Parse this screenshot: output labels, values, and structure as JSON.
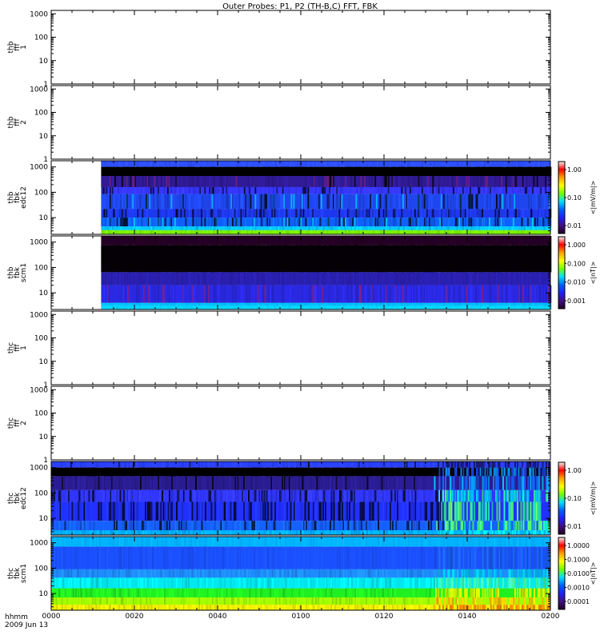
{
  "title": "Outer Probes: P1, P2 (TH-B,C) FFT, FBK",
  "footer": {
    "line1": "hhmm",
    "line2": "2009 Jun 13"
  },
  "time_ticks": [
    "0000",
    "0020",
    "0040",
    "0100",
    "0120",
    "0140",
    "0200"
  ],
  "colors": {
    "axis": "#000000",
    "background": "#ffffff"
  },
  "chart_data": [
    {
      "type": "heatmap",
      "ylabel": [
        "thb",
        "fff",
        "1"
      ],
      "ytick_labels": [
        "1",
        "10",
        "100",
        "1000"
      ],
      "ylim": [
        1,
        1400
      ],
      "yscale": "log",
      "has_data": false
    },
    {
      "type": "heatmap",
      "ylabel": [
        "thb",
        "fff",
        "2"
      ],
      "ytick_labels": [
        "1",
        "10",
        "100",
        "1000"
      ],
      "ylim": [
        1,
        1400
      ],
      "yscale": "log",
      "has_data": false
    },
    {
      "type": "heatmap",
      "ylabel": [
        "thb",
        "fbk",
        "edc12"
      ],
      "ytick_labels": [
        "10",
        "100",
        "1000"
      ],
      "ylim": [
        2.2,
        1750
      ],
      "yscale": "log",
      "has_data": true,
      "data_start_minute": 12,
      "bands": [
        {
          "lo": 1000,
          "hi": 1750,
          "c": "#2e50ff",
          "var": 0.2,
          "dark": 0
        },
        {
          "lo": 440,
          "hi": 1000,
          "c": "#000000",
          "var": 0,
          "dark": 0
        },
        {
          "lo": 160,
          "hi": 440,
          "c": "#301a95",
          "var": 0.3,
          "dark": 0.1,
          "accent": "#6a1e80"
        },
        {
          "lo": 85,
          "hi": 160,
          "c": "#3536ff",
          "var": 0.35,
          "dark": 0.2
        },
        {
          "lo": 22,
          "hi": 85,
          "c": "#1f46ee",
          "var": 0.45,
          "dark": 0.15,
          "accent": "#00b4ff"
        },
        {
          "lo": 10,
          "hi": 22,
          "c": "#1e38f0",
          "var": 0.45,
          "dark": 0.25
        },
        {
          "lo": 4.5,
          "hi": 10,
          "c": "#0f60ff",
          "var": 0.5,
          "dark": 0.3,
          "accent": "#00c8ff"
        },
        {
          "lo": 3.2,
          "hi": 4.5,
          "c": "#00c8ff",
          "var": 0.3,
          "dark": 0
        },
        {
          "lo": 2.2,
          "hi": 3.2,
          "c": "#7cf200",
          "var": 0.2,
          "dark": 0
        }
      ],
      "colorbar": {
        "label": "<|mV/m|>",
        "ticks": [
          "1.00",
          "0.10",
          "0.01"
        ]
      }
    },
    {
      "type": "heatmap",
      "ylabel": [
        "thb",
        "fbk",
        "scm1"
      ],
      "ytick_labels": [
        "10",
        "100",
        "1000"
      ],
      "ylim": [
        2.2,
        1750
      ],
      "yscale": "log",
      "has_data": true,
      "data_start_minute": 12,
      "bands": [
        {
          "lo": 750,
          "hi": 1750,
          "c": "#250025",
          "var": 0.25,
          "dark": 0
        },
        {
          "lo": 65,
          "hi": 750,
          "c": "#050005",
          "var": 0.1,
          "dark": 0
        },
        {
          "lo": 20,
          "hi": 65,
          "c": "#2a20b0",
          "var": 0.2,
          "dark": 0
        },
        {
          "lo": 4,
          "hi": 20,
          "c": "#2a28e0",
          "var": 0.3,
          "dark": 0,
          "accent": "#7a2090"
        },
        {
          "lo": 3,
          "hi": 4,
          "c": "#00c0ff",
          "var": 0.15,
          "dark": 0
        },
        {
          "lo": 2.2,
          "hi": 3,
          "c": "#00d8ff",
          "var": 0.1,
          "dark": 0
        }
      ],
      "colorbar": {
        "label": "<|nT|>",
        "ticks": [
          "1.000",
          "0.100",
          "0.010",
          "0.001"
        ]
      }
    },
    {
      "type": "heatmap",
      "ylabel": [
        "thc",
        "fff",
        "1"
      ],
      "ytick_labels": [
        "1",
        "10",
        "100",
        "1000"
      ],
      "ylim": [
        1,
        1400
      ],
      "yscale": "log",
      "has_data": false
    },
    {
      "type": "heatmap",
      "ylabel": [
        "thc",
        "fff",
        "2"
      ],
      "ytick_labels": [
        "1",
        "10",
        "100",
        "1000"
      ],
      "ylim": [
        1,
        1400
      ],
      "yscale": "log",
      "has_data": false
    },
    {
      "type": "heatmap",
      "ylabel": [
        "thc",
        "fbk",
        "edc12"
      ],
      "ytick_labels": [
        "10",
        "100",
        "1000"
      ],
      "ylim": [
        2.2,
        1750
      ],
      "yscale": "log",
      "has_data": true,
      "data_start_minute": 0,
      "bands": [
        {
          "lo": 1000,
          "hi": 1750,
          "c": "#2a40ff",
          "var": 0.3,
          "dark": 0.05,
          "late": "#1a1a80"
        },
        {
          "lo": 460,
          "hi": 1000,
          "c": "#000000",
          "var": 0,
          "dark": 0,
          "late": "#1a3cd0",
          "late_accent": "#00b0ff"
        },
        {
          "lo": 130,
          "hi": 460,
          "c": "#2a1c90",
          "var": 0.3,
          "dark": 0.1,
          "late": "#1460ff",
          "late_accent": "#00d8ff"
        },
        {
          "lo": 45,
          "hi": 130,
          "c": "#3036ff",
          "var": 0.5,
          "dark": 0.35,
          "late": "#00b8ff",
          "late_accent": "#40ff90"
        },
        {
          "lo": 8,
          "hi": 45,
          "c": "#2030ff",
          "var": 0.5,
          "dark": 0.45,
          "late": "#20e0c0",
          "late_accent": "#70ff50"
        },
        {
          "lo": 3.4,
          "hi": 8,
          "c": "#1660ff",
          "var": 0.5,
          "dark": 0.3,
          "late": "#50ff70",
          "late_accent": "#00d0ff"
        },
        {
          "lo": 2.2,
          "hi": 3.4,
          "c": "#00b0ff",
          "var": 0.3,
          "dark": 0,
          "late": "#00e0ff"
        }
      ],
      "transition_minute": 93,
      "colorbar": {
        "label": "<|mV/m|>",
        "ticks": [
          "1.00",
          "0.10",
          "0.01"
        ]
      }
    },
    {
      "type": "heatmap",
      "ylabel": [
        "thc",
        "fbk",
        "scm1"
      ],
      "ytick_labels": [
        "10",
        "100",
        "1000"
      ],
      "ylim": [
        2.2,
        1750
      ],
      "yscale": "log",
      "has_data": true,
      "data_start_minute": 0,
      "bands": [
        {
          "lo": 700,
          "hi": 1750,
          "c": "#00b4ff",
          "var": 0.15,
          "dark": 0
        },
        {
          "lo": 90,
          "hi": 700,
          "c": "#1a50ff",
          "var": 0.2,
          "dark": 0,
          "late": "#1a60ff"
        },
        {
          "lo": 42,
          "hi": 90,
          "c": "#1e8cff",
          "var": 0.3,
          "dark": 0,
          "late": "#00c8ff"
        },
        {
          "lo": 16,
          "hi": 42,
          "c": "#00e8f0",
          "var": 0.3,
          "dark": 0,
          "late": "#40ffb0"
        },
        {
          "lo": 7,
          "hi": 16,
          "c": "#20f020",
          "var": 0.35,
          "dark": 0,
          "late": "#d0ff00"
        },
        {
          "lo": 3.6,
          "hi": 7,
          "c": "#a0ff00",
          "var": 0.35,
          "dark": 0,
          "late": "#ffd000"
        },
        {
          "lo": 2.2,
          "hi": 3.6,
          "c": "#f0f000",
          "var": 0.3,
          "dark": 0,
          "late": "#ff9000"
        }
      ],
      "transition_minute": 93,
      "colorbar": {
        "label": "<|nT|>",
        "ticks": [
          "1.0000",
          "0.1000",
          "0.0100",
          "0.0010",
          "0.0001"
        ]
      }
    }
  ]
}
